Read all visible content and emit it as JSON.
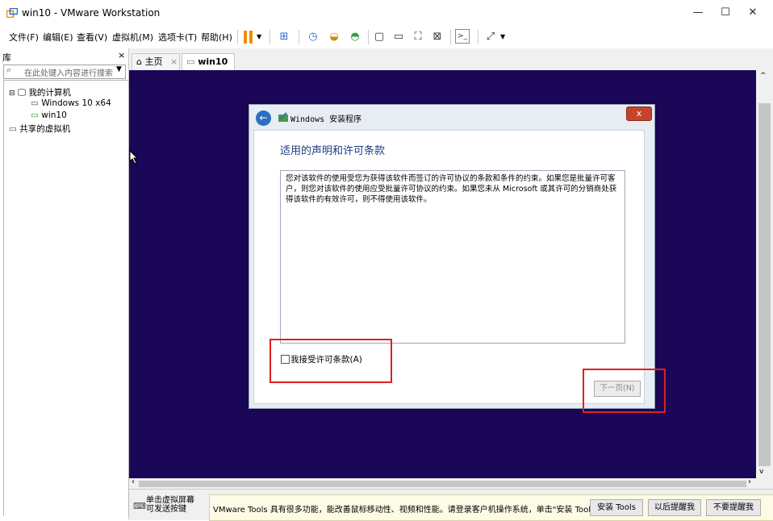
{
  "window": {
    "title": "win10 - VMware Workstation",
    "minimize": "—",
    "maximize": "☐",
    "close": "✕"
  },
  "menu": [
    "文件(F)",
    "编辑(E)",
    "查看(V)",
    "虚拟机(M)",
    "选项卡(T)",
    "帮助(H)"
  ],
  "library": {
    "header": "库",
    "close": "×",
    "search_placeholder": "在此处键入内容进行搜索",
    "tree": {
      "root": "我的计算机",
      "vms": [
        "Windows 10 x64",
        "win10"
      ],
      "shared": "共享的虚拟机"
    }
  },
  "tabs": [
    {
      "label": "主页",
      "close": "×",
      "active": false
    },
    {
      "label": "win10",
      "close": "×",
      "active": true
    }
  ],
  "dialog": {
    "title": "Windows 安装程序",
    "close": "x",
    "heading": "适用的声明和许可条款",
    "license_text": "您对该软件的使用受您为获得该软件而签订的许可协议的条款和条件的约束。如果您是批量许可客户，则您对该软件的使用应受批量许可协议的约束。如果您未从 Microsoft 或其许可的分销商处获得该软件的有效许可，则不得使用该软件。",
    "accept_label": "我接受许可条款(A)",
    "next_button": "下一页(N)"
  },
  "statusbar": {
    "hint_line1": "单击虚拟屏幕",
    "hint_line2": "可发送按键",
    "tools_message": "VMware Tools 具有很多功能，能改善鼠标移动性、视频和性能。请登录客户机操作系统，单击\"安装 Tools\"。",
    "install_tools": "安装 Tools",
    "remind_later": "以后提醒我",
    "never_remind": "不要提醒我"
  },
  "colors": {
    "vm_background": "#1b0758",
    "highlight_box": "#e02020",
    "accent": "#2d6cd0"
  }
}
